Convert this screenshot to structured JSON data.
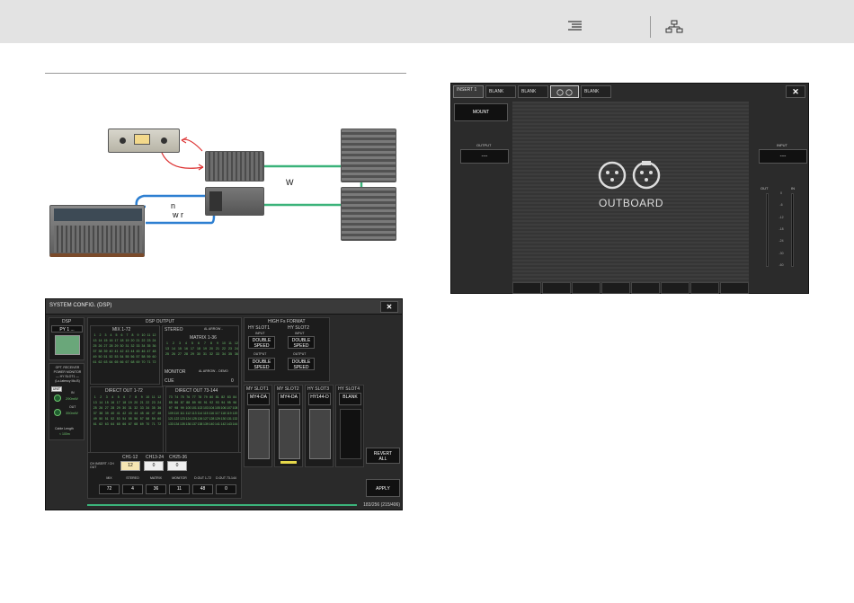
{
  "diagram": {
    "label_w1": "W",
    "label_n": "n",
    "label_wr": "w  r"
  },
  "system_config": {
    "title": "SYSTEM CONFIG. (DSP)",
    "close": "✕",
    "dsp": {
      "label": "DSP",
      "dropdown": "PY 1 ..."
    },
    "opt": {
      "lines": [
        "OPT. RECEIVER",
        "POWER MONITOR",
        "— HY SLOT1 —",
        "(Lo-latency Mo.B)"
      ],
      "unit": "UNIT",
      "in_label": "IN",
      "in_value": "290mW",
      "out_label": "OUT",
      "out_value": "350mW",
      "cable_label": "Cable Length",
      "cable_value": "< 100m"
    },
    "dsp_output": {
      "label": "DSP OUTPUT",
      "mix": "MIX 1-72",
      "stereo": "STEREO",
      "stereo_right": "AL ARROW ..",
      "matrix": "MATRIX 1-36",
      "monitor": "MONITOR",
      "monitor_right": "AL ARROW .. DEMO",
      "cue": "CUE",
      "cue_val": "0",
      "direct_1": "DIRECT OUT 1-72",
      "direct_73": "DIRECT OUT 73-144"
    },
    "hy": {
      "label": "HIGH Fs FORMAT",
      "slot1": "HY SLOT1",
      "slot2": "HY SLOT2",
      "input": "INPUT",
      "output": "OUTPUT",
      "double": "DOUBLE SPEED"
    },
    "cards": [
      {
        "slot": "MY SLOT1",
        "name": "MY4-DA"
      },
      {
        "slot": "MY SLOT2",
        "name": "MY4-DA"
      },
      {
        "slot": "HY SLOT3",
        "name": "HY144-D"
      },
      {
        "slot": "HY SLOT4",
        "name": "BLANK"
      }
    ],
    "insert": {
      "label": "CH INSERT / CH OUT",
      "tabs": [
        "CH1-12",
        "CH13-24",
        "CH25-36"
      ],
      "values": [
        "12",
        "0",
        "0"
      ]
    },
    "totals": [
      {
        "label": "MIX",
        "value": "72"
      },
      {
        "label": "STEREO",
        "value": "4"
      },
      {
        "label": "MATRIX",
        "value": "36"
      },
      {
        "label": "MONITOR",
        "value": "11"
      },
      {
        "label": "D.OUT 1-72",
        "value": "48"
      },
      {
        "label": "D.OUT 73-144",
        "value": "0"
      }
    ],
    "revert_all": "REVERT ALL",
    "apply": "APPLY",
    "count": "183/256 (215/406)"
  },
  "insert_panel": {
    "tabs": [
      "INSERT 1",
      "BLANK",
      "BLANK",
      "",
      "BLANK"
    ],
    "tab_sub": "INSERT 1",
    "close": "✕",
    "mount": "MOUNT",
    "output": "OUTPUT",
    "output_value": "----",
    "input": "INPUT",
    "input_value": "----",
    "outboard": "OUTBOARD",
    "meter_out": "OUT",
    "meter_in": "IN",
    "meter_scale": [
      "0",
      "-6",
      "-12",
      "-18",
      "-24",
      "-30",
      "-60"
    ]
  }
}
